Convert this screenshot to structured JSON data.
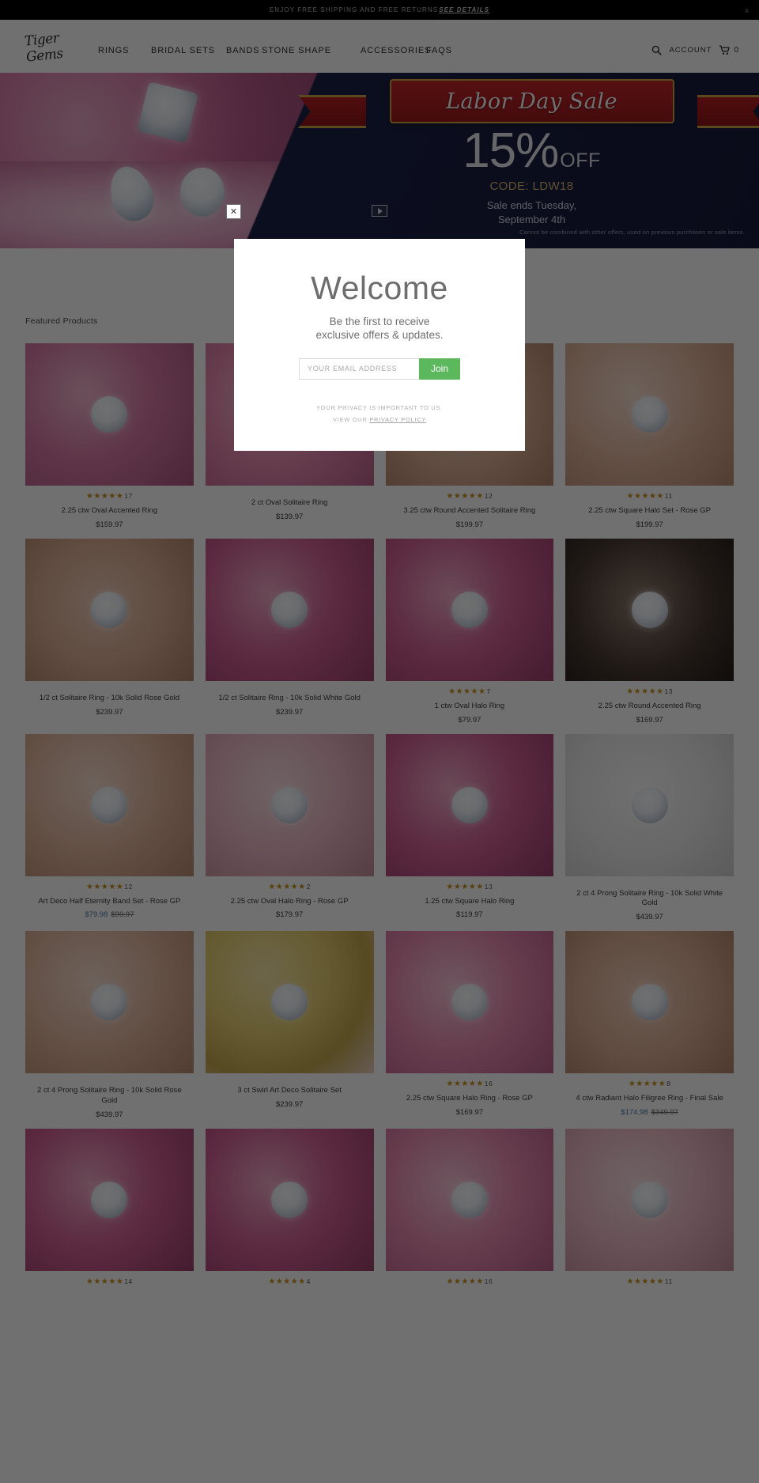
{
  "announcement": {
    "text": "Enjoy free shipping and free returns",
    "link_label": "See Details",
    "close_label": "x"
  },
  "header": {
    "logo_text": "Tiger Gems",
    "nav": [
      {
        "label": "Rings"
      },
      {
        "label": "Bridal Sets"
      },
      {
        "label": "Bands"
      },
      {
        "label": "Stone Shape"
      },
      {
        "label": "Accessories"
      },
      {
        "label": "FAQs"
      }
    ],
    "search_icon": "search-icon",
    "account_label": "Account",
    "cart_icon": "cart-icon",
    "cart_count": "0"
  },
  "hero": {
    "ribbon_text": "Labor Day Sale",
    "percent": "15%",
    "off_label": "OFF",
    "code_line": "CODE: LDW18",
    "ends_line": "Sale ends Tuesday,\nSeptember 4th",
    "disclaimer": "Cannot be combined with other offers, used on previous purchases or sale items.",
    "play_icon": "play-icon"
  },
  "main": {
    "section_title": "Featured Products",
    "products": [
      {
        "title": "2.25 ctw Oval Accented Ring",
        "price": "$159.97",
        "rating": "★★★★★",
        "review_count": "17",
        "tint": "img-rose"
      },
      {
        "title": "2 ct Oval Solitaire Ring",
        "price": "$139.97",
        "rating": "",
        "review_count": "",
        "tint": "img-pink"
      },
      {
        "title": "3.25 ctw Round Accented Solitaire Ring",
        "price": "$199.97",
        "rating": "★★★★★",
        "review_count": "12",
        "tint": "img-hand"
      },
      {
        "title": "2.25 ctw Square Halo Set - Rose GP",
        "price": "$199.97",
        "rating": "★★★★★",
        "review_count": "11",
        "tint": "img-rosegold"
      },
      {
        "title": "1/2 ct Solitaire Ring - 10k Solid Rose Gold",
        "price": "$239.97",
        "rating": "",
        "review_count": "",
        "tint": "img-hand"
      },
      {
        "title": "1/2 ct Solitaire Ring - 10k Solid White Gold",
        "price": "$239.97",
        "rating": "",
        "review_count": "",
        "tint": "img-magenta"
      },
      {
        "title": "1 ctw Oval Halo Ring",
        "price": "$79.97",
        "rating": "★★★★★",
        "review_count": "7",
        "tint": "img-magenta"
      },
      {
        "title": "2.25 ctw Round Accented Ring",
        "price": "$169.97",
        "rating": "★★★★★",
        "review_count": "13",
        "tint": "img-dark"
      },
      {
        "title": "Art Deco Half Eternity Band Set - Rose GP",
        "price": "",
        "sale_price": "$79.98",
        "was_price": "$99.97",
        "rating": "★★★★★",
        "review_count": "12",
        "tint": "img-rosegold"
      },
      {
        "title": "2.25 ctw Oval Halo Ring - Rose GP",
        "price": "$179.97",
        "rating": "★★★★★",
        "review_count": "2",
        "tint": "img-blush"
      },
      {
        "title": "1.25 ctw Square Halo Ring",
        "price": "$119.97",
        "rating": "★★★★★",
        "review_count": "13",
        "tint": "img-magenta"
      },
      {
        "title": "2 ct 4 Prong Solitaire Ring - 10k Solid White Gold",
        "price": "$439.97",
        "rating": "",
        "review_count": "",
        "tint": "img-white"
      },
      {
        "title": "2 ct 4 Prong Solitaire Ring - 10k Solid Rose Gold",
        "price": "$439.97",
        "rating": "",
        "review_count": "",
        "tint": "img-rosegold"
      },
      {
        "title": "3 ct Swirl Art Deco Solitaire Set",
        "price": "$239.97",
        "rating": "",
        "review_count": "",
        "tint": "img-yellow"
      },
      {
        "title": "2.25 ctw Square Halo Ring - Rose GP",
        "price": "$169.97",
        "rating": "★★★★★",
        "review_count": "16",
        "tint": "img-pink"
      },
      {
        "title": "4 ctw Radiant Halo Filigree Ring - Final Sale",
        "price": "",
        "sale_price": "$174.98",
        "was_price": "$349.97",
        "rating": "★★★★★",
        "review_count": "8",
        "tint": "img-hand"
      },
      {
        "title": "",
        "price": "",
        "rating": "★★★★★",
        "review_count": "14",
        "tint": "img-magenta"
      },
      {
        "title": "",
        "price": "",
        "rating": "★★★★★",
        "review_count": "4",
        "tint": "img-magenta"
      },
      {
        "title": "",
        "price": "",
        "rating": "★★★★★",
        "review_count": "16",
        "tint": "img-pink"
      },
      {
        "title": "",
        "price": "",
        "rating": "★★★★★",
        "review_count": "11",
        "tint": "img-blush"
      }
    ]
  },
  "modal": {
    "close_label": "✕",
    "title": "Welcome",
    "subtitle": "Be the first to receive\nexclusive offers & updates.",
    "email_placeholder": "Your Email Address",
    "email_value": "",
    "join_label": "Join",
    "privacy_line1": "Your privacy is important to us.",
    "privacy_line2_prefix": "View our ",
    "privacy_link": "Privacy Policy"
  },
  "colors": {
    "accent_green": "#5cb85c",
    "star_gold": "#c8921c",
    "sale_blue": "#4a7ea8",
    "navy": "#1b2147",
    "ribbon_red": "#c42529"
  }
}
